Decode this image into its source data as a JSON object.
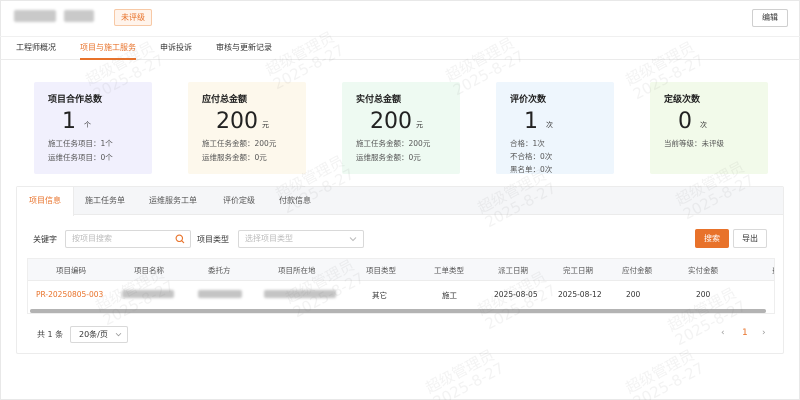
{
  "header": {
    "rating_badge": "未评级",
    "edit_label": "编辑"
  },
  "top_tabs": [
    "工程师概况",
    "项目与施工服务",
    "申诉投诉",
    "审核与更新记录"
  ],
  "stats": [
    {
      "title": "项目合作总数",
      "value": "1",
      "unit": "个",
      "lines": [
        "施工任务项目：1个",
        "运维任务项目：0个"
      ]
    },
    {
      "title": "应付总金额",
      "value": "200",
      "unit": "元",
      "lines": [
        "施工任务金额：200元",
        "运维服务金额：0元"
      ]
    },
    {
      "title": "实付总金额",
      "value": "200",
      "unit": "元",
      "lines": [
        "施工任务金额：200元",
        "运维服务金额：0元"
      ]
    },
    {
      "title": "评价次数",
      "value": "1",
      "unit": "次",
      "lines": [
        "合格：1次",
        "不合格：0次",
        "黑名单：0次"
      ]
    },
    {
      "title": "定级次数",
      "value": "0",
      "unit": "次",
      "lines": [
        "当前等级：未评级"
      ]
    }
  ],
  "sub_tabs": [
    "项目信息",
    "施工任务单",
    "运维服务工单",
    "评价定级",
    "付款信息"
  ],
  "filters": {
    "keyword_label": "关键字",
    "keyword_placeholder": "按项目搜索",
    "type_label": "项目类型",
    "type_placeholder": "选择项目类型",
    "search_label": "搜索",
    "export_label": "导出"
  },
  "table": {
    "columns": [
      "项目编码",
      "项目名称",
      "委托方",
      "项目所在地",
      "项目类型",
      "工单类型",
      "派工日期",
      "完工日期",
      "应付金额",
      "实付金额",
      "费"
    ],
    "rows": [
      {
        "code": "PR-20250805-003",
        "type": "其它",
        "order_type": "施工",
        "dispatch_date": "2025-08-05",
        "finish_date": "2025-08-12",
        "payable": "200",
        "paid": "200"
      }
    ]
  },
  "pagination": {
    "total": "共 1 条",
    "page_size": "20条/页",
    "current_page": "1",
    "prev": "‹",
    "next": "›"
  },
  "watermark": {
    "line1": "超级管理员",
    "line2": "2025-8-27"
  },
  "colors": {
    "accent": "#e8722a",
    "card_purple": "#f1f0fd",
    "card_yellow": "#fdf8ec",
    "card_green": "#eefaf2",
    "card_blue": "#eef6fd",
    "card_lime": "#f2faea"
  }
}
